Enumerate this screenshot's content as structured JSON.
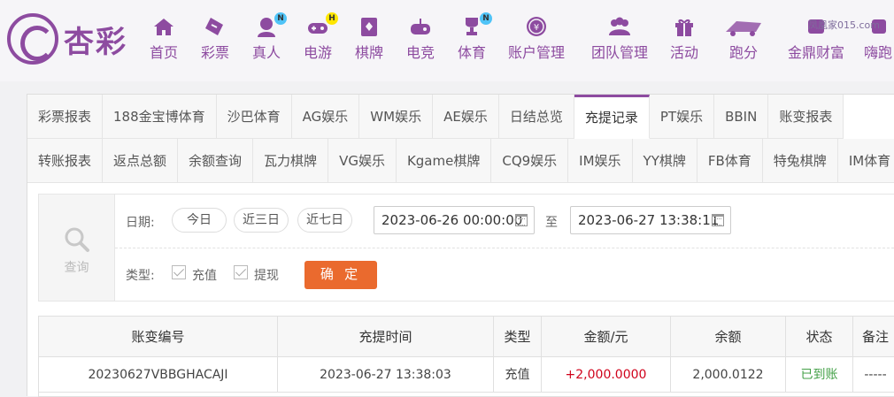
{
  "brand": {
    "logo_text": "杏彩"
  },
  "colors": {
    "brand": "#8d4ba0",
    "confirm": "#ea6a2e",
    "amount": "#d0021b",
    "status": "#43a047"
  },
  "nav": [
    {
      "label": "首页",
      "icon": "home-icon"
    },
    {
      "label": "彩票",
      "icon": "ticket-icon"
    },
    {
      "label": "真人",
      "icon": "dealer-icon",
      "badge": "N"
    },
    {
      "label": "电游",
      "icon": "gamepad-icon",
      "badge": "H"
    },
    {
      "label": "棋牌",
      "icon": "cards-icon"
    },
    {
      "label": "电竞",
      "icon": "joystick-icon"
    },
    {
      "label": "体育",
      "icon": "trophy-icon",
      "badge": "N"
    },
    {
      "label": "账户管理",
      "icon": "yen-icon"
    },
    {
      "label": "团队管理",
      "icon": "team-icon"
    },
    {
      "label": "活动",
      "icon": "gift-icon"
    },
    {
      "label": "跑分",
      "icon": "runner-icon"
    },
    {
      "label": "金鼎财富",
      "icon": "wealth-icon"
    },
    {
      "label": "嗨跑",
      "icon": "hipao-icon"
    }
  ],
  "watermark": "凤凰家015.com",
  "tabs_row1": [
    "彩票报表",
    "188金宝博体育",
    "沙巴体育",
    "AG娱乐",
    "WM娱乐",
    "AE娱乐",
    "日结总览",
    "充提记录",
    "PT娱乐",
    "BBIN",
    "账变报表"
  ],
  "tabs_row2": [
    "转账报表",
    "返点总额",
    "余额查询",
    "瓦力棋牌",
    "VG娱乐",
    "Kgame棋牌",
    "CQ9娱乐",
    "IM娱乐",
    "YY棋牌",
    "FB体育",
    "特兔棋牌",
    "IM体育"
  ],
  "active_tab": "充提记录",
  "query": {
    "side_label": "查询",
    "date_label": "日期:",
    "quick_ranges": [
      "今日",
      "近三日",
      "近七日"
    ],
    "start": "2023-06-26 00:00:00",
    "to": "至",
    "end": "2023-06-27 13:38:11",
    "type_label": "类型:",
    "types": [
      "充值",
      "提现"
    ],
    "confirm": "确 定"
  },
  "table": {
    "headers": [
      "账变编号",
      "充提时间",
      "类型",
      "金额/元",
      "余额",
      "状态",
      "备注"
    ],
    "rows": [
      [
        "20230627VBBGHACAJI",
        "2023-06-27 13:38:03",
        "充值",
        "+2,000.0000",
        "2,000.0122",
        "已到账",
        "-----"
      ]
    ]
  }
}
